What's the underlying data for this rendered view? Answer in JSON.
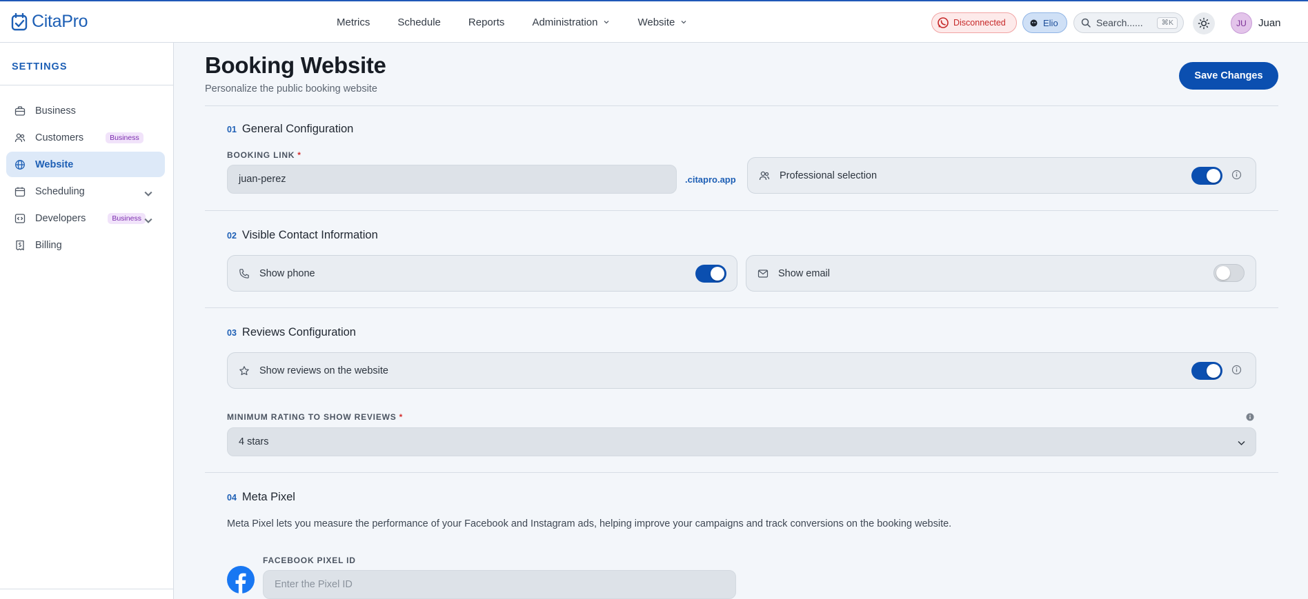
{
  "app": {
    "name": "CitaPro"
  },
  "nav": {
    "items": [
      {
        "label": "Metrics"
      },
      {
        "label": "Schedule"
      },
      {
        "label": "Reports"
      },
      {
        "label": "Administration",
        "dropdown": true
      },
      {
        "label": "Website",
        "dropdown": true
      }
    ]
  },
  "status": {
    "whatsapp_label": "Disconnected",
    "assistant_label": "Elio"
  },
  "search": {
    "placeholder": "Search......",
    "shortcut": "⌘K"
  },
  "user": {
    "initials": "JU",
    "name": "Juan"
  },
  "sidebar": {
    "title": "SETTINGS",
    "items": [
      {
        "label": "Business",
        "icon": "briefcase-icon"
      },
      {
        "label": "Customers",
        "badge": "Business",
        "icon": "users-icon"
      },
      {
        "label": "Website",
        "active": true,
        "icon": "globe-icon"
      },
      {
        "label": "Scheduling",
        "icon": "calendar-icon",
        "expandable": true
      },
      {
        "label": "Developers",
        "badge": "Business",
        "icon": "code-icon",
        "expandable": true
      },
      {
        "label": "Billing",
        "icon": "receipt-icon"
      }
    ]
  },
  "page": {
    "title": "Booking Website",
    "subtitle": "Personalize the public booking website",
    "save_label": "Save Changes"
  },
  "sections": {
    "general": {
      "number": "01",
      "title": "General Configuration",
      "booking_link_label": "BOOKING LINK",
      "required_mark": "*",
      "booking_link_value": "juan-perez",
      "domain_suffix": ".citapro.app",
      "professional_selection_label": "Professional selection",
      "professional_selection_on": true
    },
    "contact": {
      "number": "02",
      "title": "Visible Contact Information",
      "show_phone_label": "Show phone",
      "show_phone_on": true,
      "show_email_label": "Show email",
      "show_email_on": false
    },
    "reviews": {
      "number": "03",
      "title": "Reviews Configuration",
      "show_reviews_label": "Show reviews on the website",
      "show_reviews_on": true,
      "min_rating_label": "MINIMUM RATING TO SHOW REVIEWS",
      "required_mark": "*",
      "min_rating_value": "4 stars"
    },
    "meta": {
      "number": "04",
      "title": "Meta Pixel",
      "description": "Meta Pixel lets you measure the performance of your Facebook and Instagram ads, helping improve your campaigns and track conversions on the booking website.",
      "pixel_label": "FACEBOOK PIXEL ID",
      "pixel_placeholder": "Enter the Pixel ID"
    }
  },
  "colors": {
    "brand": "#0b4fb0",
    "accent_text": "#1d5fb5",
    "danger": "#c62828",
    "badge_purple": "#7b2cae"
  }
}
